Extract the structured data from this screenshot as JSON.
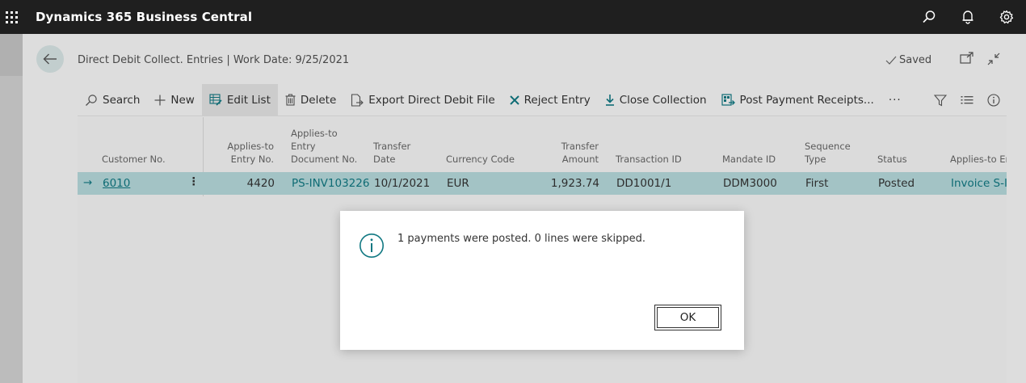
{
  "app": {
    "title": "Dynamics 365 Business Central"
  },
  "appbar": {
    "icons": [
      "search-icon",
      "bell-icon",
      "gear-icon"
    ]
  },
  "page": {
    "title": "Direct Debit Collect. Entries | Work Date: 9/25/2021",
    "saved_label": "Saved"
  },
  "actions": {
    "search": "Search",
    "new": "New",
    "edit_list": "Edit List",
    "delete": "Delete",
    "export": "Export Direct Debit File",
    "reject": "Reject Entry",
    "close": "Close Collection",
    "post": "Post Payment Receipts...",
    "more": "···"
  },
  "columns": {
    "customer_no": "Customer No.",
    "applies_entry_1": "Applies-to",
    "applies_entry_2": "Entry No.",
    "applies_doc_1": "Applies-to",
    "applies_doc_2": "Entry",
    "applies_doc_3": "Document No.",
    "transfer_date_1": "Transfer",
    "transfer_date_2": "Date",
    "currency": "Currency Code",
    "transfer_amount_1": "Transfer",
    "transfer_amount_2": "Amount",
    "transaction_id": "Transaction ID",
    "mandate_id": "Mandate ID",
    "sequence_1": "Sequence",
    "sequence_2": "Type",
    "status": "Status",
    "applies_en": "Applies-to En"
  },
  "row": {
    "arrow": "→",
    "customer_no": "6010",
    "menu": "⋮",
    "entry_no": "4420",
    "doc_no": "PS-INV103226",
    "transfer_date": "10/1/2021",
    "currency": "EUR",
    "amount": "1,923.74",
    "transaction_id": "DD1001/1",
    "mandate_id": "DDM3000",
    "sequence": "First",
    "status": "Posted",
    "applies_en": "Invoice S-IN"
  },
  "dialog": {
    "message": "1 payments were posted. 0 lines were skipped.",
    "ok_label": "OK"
  },
  "colors": {
    "accent": "#107882",
    "selected_row": "#b6dadc",
    "appbar": "#1f1f1f"
  }
}
